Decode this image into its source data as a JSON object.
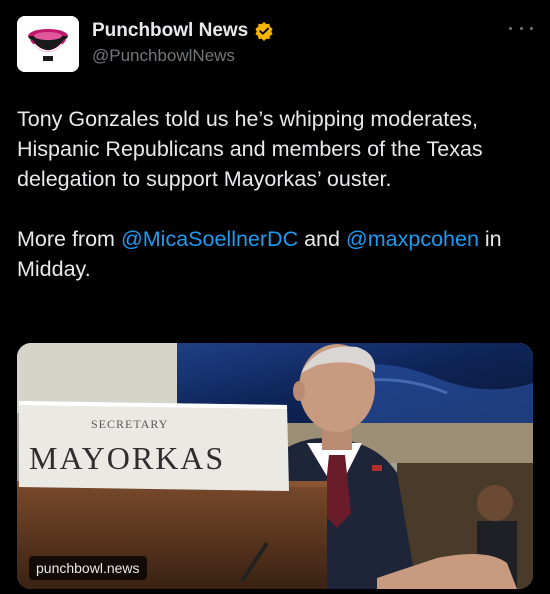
{
  "account": {
    "display_name": "Punchbowl News",
    "handle": "@PunchbowlNews",
    "verified": true,
    "verified_color": "#f4b400",
    "avatar_icon": "punchbowl-logo"
  },
  "more_icon": "ellipsis-icon",
  "tweet": {
    "paragraph1": "Tony Gonzales told us he’s whipping moderates, Hispanic Republicans and members of the Texas delegation to support Mayorkas’ ouster.",
    "p2_prefix": "More from ",
    "mention1": "@MicaSoellnerDC",
    "p2_mid": " and ",
    "mention2": "@maxpcohen",
    "p2_suffix": " in Midday.",
    "mention_color": "#1d9bf0"
  },
  "media": {
    "placard_top": "SECRETARY",
    "placard_name": "MAYORKAS",
    "link_domain": "punchbowl.news"
  }
}
